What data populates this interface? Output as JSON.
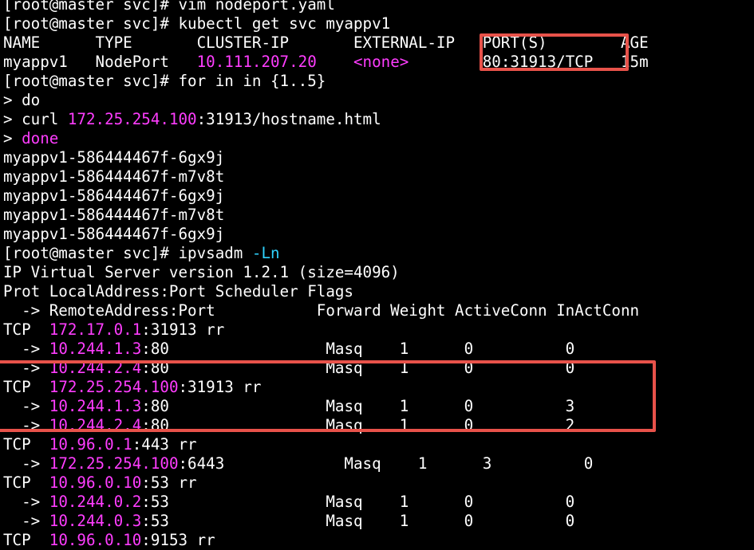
{
  "terminal": {
    "lines": [
      [
        {
          "t": "[root@master svc]# vim nodeport.yaml"
        }
      ],
      [
        {
          "t": "[root@master svc]# kubectl get svc myappv1"
        }
      ],
      [
        {
          "t": "NAME      TYPE       CLUSTER-IP       EXTERNAL-IP   PORT(S)        AGE"
        }
      ],
      [
        {
          "t": "myappv1   NodePort   "
        },
        {
          "t": "10.111.207.20",
          "c": "mag"
        },
        {
          "t": "    "
        },
        {
          "t": "<none>",
          "c": "mag"
        },
        {
          "t": "        80:31913/TCP   15m"
        }
      ],
      [
        {
          "t": "[root@master svc]# for in in {1..5}"
        }
      ],
      [
        {
          "t": "> do"
        }
      ],
      [
        {
          "t": "> curl "
        },
        {
          "t": "172.25.254.100",
          "c": "mag"
        },
        {
          "t": ":31913/hostname.html"
        }
      ],
      [
        {
          "t": "> "
        },
        {
          "t": "done",
          "c": "mag"
        }
      ],
      [
        {
          "t": "myappv1-586444467f-6gx9j"
        }
      ],
      [
        {
          "t": "myappv1-586444467f-m7v8t"
        }
      ],
      [
        {
          "t": "myappv1-586444467f-6gx9j"
        }
      ],
      [
        {
          "t": "myappv1-586444467f-m7v8t"
        }
      ],
      [
        {
          "t": "myappv1-586444467f-6gx9j"
        }
      ],
      [
        {
          "t": "[root@master svc]# ipvsadm "
        },
        {
          "t": "-Ln",
          "c": "cyan"
        }
      ],
      [
        {
          "t": "IP Virtual Server version 1.2.1 (size=4096)"
        }
      ],
      [
        {
          "t": "Prot LocalAddress:Port Scheduler Flags"
        }
      ],
      [
        {
          "t": "  -> RemoteAddress:Port           Forward Weight ActiveConn InActConn"
        }
      ],
      [
        {
          "t": "TCP  "
        },
        {
          "t": "172.17.0.1",
          "c": "mag"
        },
        {
          "t": ":31913 rr"
        }
      ],
      [
        {
          "t": "  -> "
        },
        {
          "t": "10.244.1.3",
          "c": "mag"
        },
        {
          "t": ":80                 Masq    1      0          0"
        }
      ],
      [
        {
          "t": "  -> "
        },
        {
          "t": "10.244.2.4",
          "c": "mag"
        },
        {
          "t": ":80                 Masq    1      0          0"
        }
      ],
      [
        {
          "t": "TCP  "
        },
        {
          "t": "172.25.254.100",
          "c": "mag"
        },
        {
          "t": ":31913 rr"
        }
      ],
      [
        {
          "t": "  -> "
        },
        {
          "t": "10.244.1.3",
          "c": "mag"
        },
        {
          "t": ":80                 Masq    1      0          3"
        }
      ],
      [
        {
          "t": "  -> "
        },
        {
          "t": "10.244.2.4",
          "c": "mag"
        },
        {
          "t": ":80                 Masq    1      0          2"
        }
      ],
      [
        {
          "t": "TCP  "
        },
        {
          "t": "10.96.0.1",
          "c": "mag"
        },
        {
          "t": ":443 rr"
        }
      ],
      [
        {
          "t": "  -> "
        },
        {
          "t": "172.25.254.100",
          "c": "mag"
        },
        {
          "t": ":6443             Masq    1      3          0"
        }
      ],
      [
        {
          "t": "TCP  "
        },
        {
          "t": "10.96.0.10",
          "c": "mag"
        },
        {
          "t": ":53 rr"
        }
      ],
      [
        {
          "t": "  -> "
        },
        {
          "t": "10.244.0.2",
          "c": "mag"
        },
        {
          "t": ":53                 Masq    1      0          0"
        }
      ],
      [
        {
          "t": "  -> "
        },
        {
          "t": "10.244.0.3",
          "c": "mag"
        },
        {
          "t": ":53                 Masq    1      0          0"
        }
      ],
      [
        {
          "t": "TCP  "
        },
        {
          "t": "10.96.0.10",
          "c": "mag"
        },
        {
          "t": ":9153 rr"
        }
      ]
    ]
  },
  "colors": {
    "background": "#000000",
    "text": "#ffffff",
    "highlight_text": "#ff3dff",
    "flag_text": "#2fd3ff",
    "annotation_box": "#e8524a"
  }
}
